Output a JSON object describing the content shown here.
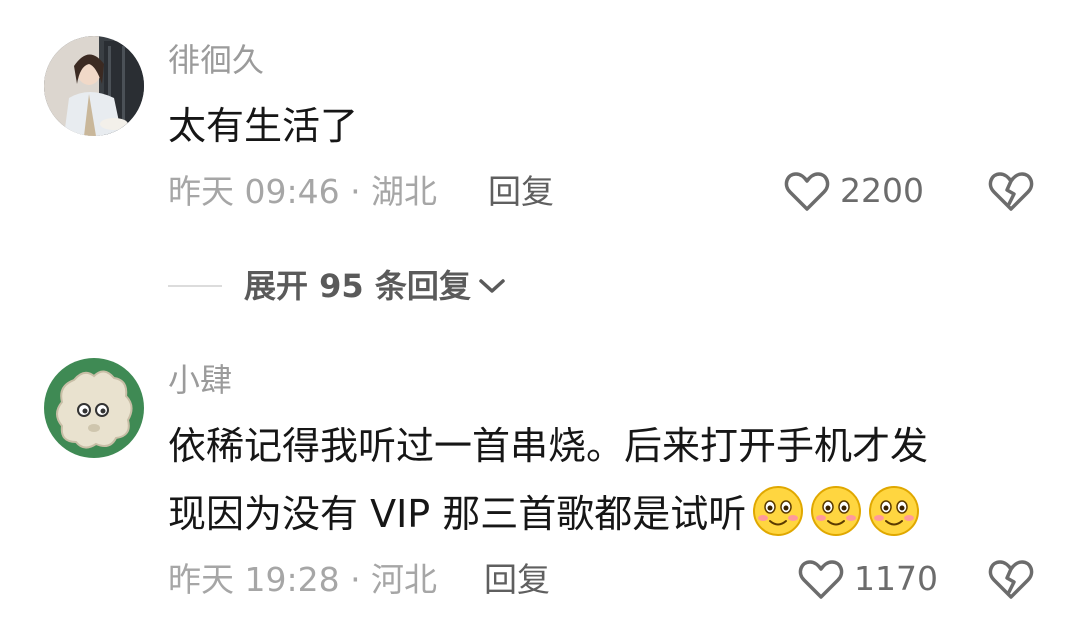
{
  "comments": [
    {
      "username": "徘徊久",
      "text": "太有生活了",
      "meta": "昨天 09:46 · 湖北",
      "reply_label": "回复",
      "likes": "2200",
      "expand_replies": "展开 95 条回复"
    },
    {
      "username": "小肆",
      "text_line1": "依稀记得我听过一首串烧。后来打开手机才发",
      "text_line2": "现因为没有 VIP 那三首歌都是试听",
      "meta": "昨天 19:28 · 河北",
      "reply_label": "回复",
      "likes": "1170"
    }
  ],
  "icons": {
    "like": "heart-outline-icon",
    "dislike": "broken-heart-icon",
    "expand": "chevron-down-icon",
    "emoji": "blushing-smile-emoji"
  },
  "colors": {
    "username": "#9b9b9b",
    "text": "#161616",
    "meta": "#a6a6a6",
    "reply": "#5f5f5f",
    "avatar2_bg": "#3f8a54"
  }
}
